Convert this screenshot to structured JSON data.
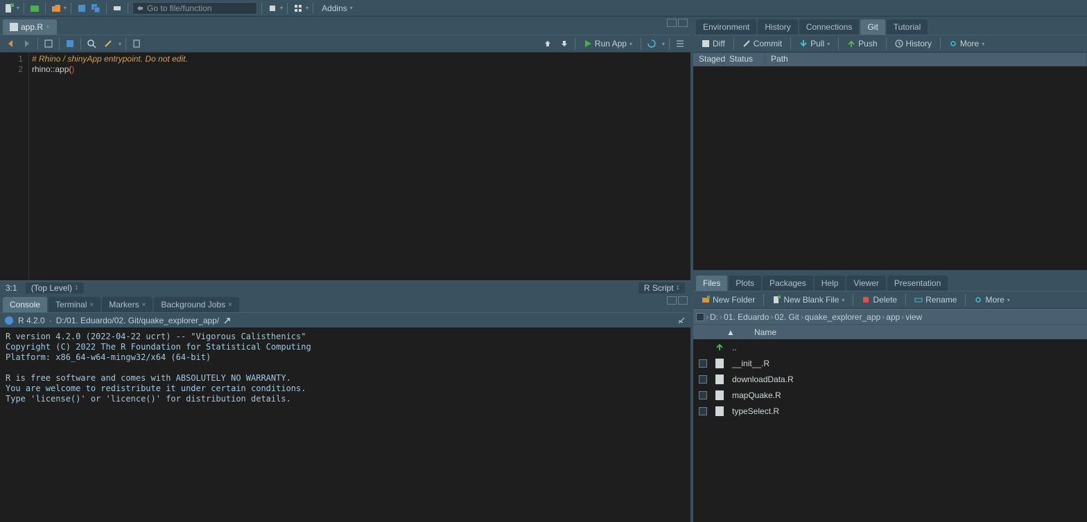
{
  "top": {
    "goto_placeholder": "Go to file/function",
    "addins": "Addins"
  },
  "editor": {
    "tab_filename": "app.R",
    "line1_comment": "# Rhino / shinyApp entrypoint. Do not edit.",
    "line2_code_ns": "rhino",
    "line2_code_op": "::",
    "line2_code_fn": "app",
    "status_pos": "3:1",
    "status_scope": "(Top Level)",
    "status_lang": "R Script",
    "run_label": "Run App"
  },
  "console": {
    "tabs": [
      "Console",
      "Terminal",
      "Markers",
      "Background Jobs"
    ],
    "r_version": "R 4.2.0",
    "wd": "D:/01. Eduardo/02. Git/quake_explorer_app/",
    "output": "R version 4.2.0 (2022-04-22 ucrt) -- \"Vigorous Calisthenics\"\nCopyright (C) 2022 The R Foundation for Statistical Computing\nPlatform: x86_64-w64-mingw32/x64 (64-bit)\n\nR is free software and comes with ABSOLUTELY NO WARRANTY.\nYou are welcome to redistribute it under certain conditions.\nType 'license()' or 'licence()' for distribution details."
  },
  "env_pane": {
    "tabs": [
      "Environment",
      "History",
      "Connections",
      "Git",
      "Tutorial"
    ],
    "active_tab": "Git",
    "btn_diff": "Diff",
    "btn_commit": "Commit",
    "btn_pull": "Pull",
    "btn_push": "Push",
    "btn_history": "History",
    "btn_more": "More",
    "hdr_staged": "Staged",
    "hdr_status": "Status",
    "hdr_path": "Path"
  },
  "files_pane": {
    "tabs": [
      "Files",
      "Plots",
      "Packages",
      "Help",
      "Viewer",
      "Presentation"
    ],
    "active_tab": "Files",
    "btn_newfolder": "New Folder",
    "btn_newblank": "New Blank File",
    "btn_delete": "Delete",
    "btn_rename": "Rename",
    "btn_more": "More",
    "breadcrumb": [
      "D:",
      "01. Eduardo",
      "02. Git",
      "quake_explorer_app",
      "app",
      "view"
    ],
    "hdr_name": "Name",
    "parent_dir": "..",
    "files": [
      "__init__.R",
      "downloadData.R",
      "mapQuake.R",
      "typeSelect.R"
    ]
  }
}
